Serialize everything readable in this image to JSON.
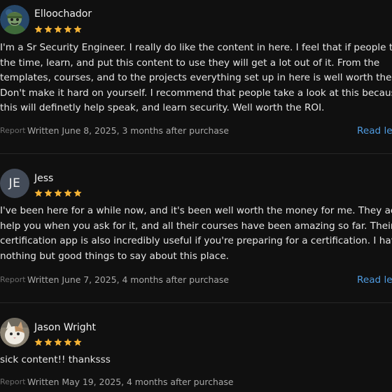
{
  "colors": {
    "background": "#101010",
    "star": "#f5b335",
    "link": "#4f9be0",
    "initials_avatar": "#434b58"
  },
  "reviews": [
    {
      "name": "Elloochador",
      "avatar_type": "image",
      "avatar_icon": "cartoon-soldier-avatar",
      "rating": 5,
      "body_lines": [
        "I'm a Sr Security Engineer. I really do like the content in here. I feel that if people take",
        "the time, learn, and put this content to use they will get a lot out of it. From the",
        "templates, courses, and to the projects everything set up in here is well worth the value.",
        "Don't make it hard on yourself. I recommend that people take a look at this because",
        "this will definetly help speak, and learn security. Well worth the ROI."
      ],
      "report": "Report",
      "written": "Written June 8, 2025, 3 months after purchase",
      "read_less": "Read less"
    },
    {
      "name": "Jess",
      "avatar_type": "initials",
      "initials": "JE",
      "rating": 5,
      "body_lines": [
        "I've been here for a while now, and it's been well worth the money for me. They actually",
        "help you when you ask for it, and all their courses have been amazing so far. Their",
        "certification app is also incredibly useful if you're preparing for a certification. I have",
        "nothing but good things to say about this place."
      ],
      "report": "Report",
      "written": "Written June 7, 2025, 4 months after purchase",
      "read_less": "Read less"
    },
    {
      "name": "Jason Wright",
      "avatar_type": "image",
      "avatar_icon": "cat-photo-avatar",
      "rating": 5,
      "body_lines": [
        "sick content!! thanksss"
      ],
      "report": "Report",
      "written": "Written May 19, 2025, 4 months after purchase"
    }
  ]
}
